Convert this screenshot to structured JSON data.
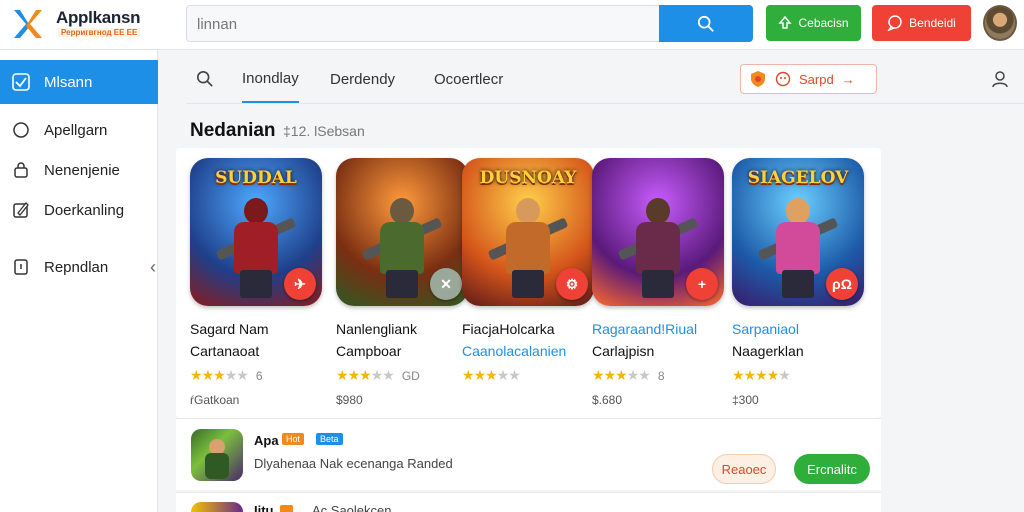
{
  "header": {
    "brand": "Applkansn",
    "tagline": "Рерригвгнод ЕЕ ЕЕ",
    "search_value": "linnan",
    "btn_green_label": "Cebacisn",
    "btn_red_label": "Bendeidi"
  },
  "sidebar": {
    "items": [
      {
        "label": "Mlsann",
        "icon": "check-box-icon"
      },
      {
        "label": "Apellgarn",
        "icon": "circle-icon"
      },
      {
        "label": "Nenenjenie",
        "icon": "lock-icon"
      },
      {
        "label": "Doerkanling",
        "icon": "edit-icon"
      },
      {
        "label": "Repndlan",
        "icon": "bookmark-icon"
      }
    ]
  },
  "tabs": {
    "items": [
      "Inondlay",
      "Derdendy",
      "Ocoertlecr"
    ],
    "promo_label": "Sarpd"
  },
  "section": {
    "title": "Nedanian",
    "subtitle": "‡12. lSebsan"
  },
  "cards": [
    {
      "art_title": "SUDDAL",
      "line1": "Sagard Nam",
      "line2": "Cartanaoat",
      "stars": 3,
      "rating": "6",
      "price": "ŕGatkoan",
      "accent": "#1f3f8a",
      "badge": "#ef4136",
      "badge_text": "✈"
    },
    {
      "art_title": "",
      "line1": "Nanlengliank",
      "line2": "Campboar",
      "stars": 3,
      "rating": "GD",
      "price": "$980",
      "accent": "#7a2e12",
      "badge": "#9aa89a",
      "badge_text": "✕"
    },
    {
      "art_title": "DUSNOAY",
      "line1": "FiacjaHolcarka",
      "line2": "Caanolacalanien",
      "stars": 3,
      "rating": "",
      "price": "",
      "accent": "#a0351a",
      "badge": "#ef4136",
      "badge_text": "⚙"
    },
    {
      "art_title": "",
      "line1": "Ragaraand!Riual",
      "line2": "Carlajpisn",
      "stars": 3,
      "rating": "8",
      "price": "$.680",
      "accent": "#5a1a7a",
      "badge": "#ef4136",
      "badge_text": "+"
    },
    {
      "art_title": "SIAGELOV",
      "line1": "Sarpaniaol",
      "line2": "Naagerklan",
      "stars": 4,
      "rating": "",
      "price": "‡300",
      "accent": "#1d5aa8",
      "badge": "#ef4136",
      "badge_text": "ρΩ"
    }
  ],
  "list": [
    {
      "title": "Apa",
      "tag_orange": "Hot",
      "tag_blue": "Beta",
      "desc": "Dlyahenaa Nak ecenanga Randed",
      "btn_light": "Reaoec",
      "btn_green": "Ercnalitc"
    }
  ],
  "list2": {
    "title": "Iitu",
    "desc": "Ac Saolekcen"
  }
}
